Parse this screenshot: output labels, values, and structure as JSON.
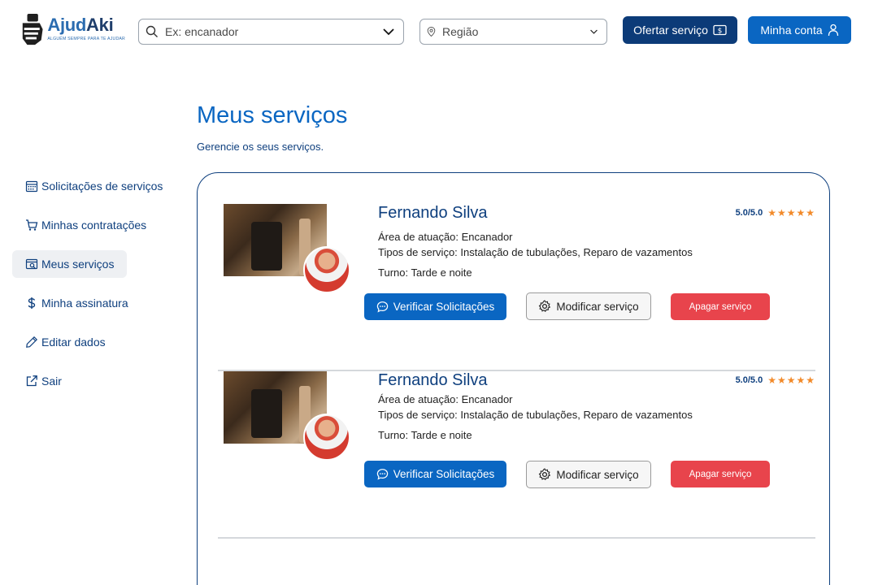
{
  "header": {
    "logo_name_part1": "Ajud",
    "logo_name_part2": "Aki",
    "logo_tagline": "ALGUÉM SEMPRE PARA TE AJUDAR",
    "search_placeholder": "Ex: encanador",
    "region_placeholder": "Região",
    "ofertar_label": "Ofertar serviço",
    "conta_label": "Minha conta"
  },
  "sidebar": {
    "items": [
      {
        "label": "Solicitações de serviços",
        "icon": "calendar-icon"
      },
      {
        "label": "Minhas contratações",
        "icon": "cart-icon"
      },
      {
        "label": "Meus serviços",
        "icon": "services-icon",
        "active": true
      },
      {
        "label": "Minha assinatura",
        "icon": "dollar-icon"
      },
      {
        "label": "Editar dados",
        "icon": "pencil-icon"
      },
      {
        "label": "Sair",
        "icon": "external-link-icon"
      }
    ]
  },
  "main": {
    "title": "Meus serviços",
    "subtitle": "Gerencie os seus serviços.",
    "services": [
      {
        "name": "Fernando Silva",
        "rating": "5.0/5.0",
        "stars": 5,
        "area": "Área de atuação: Encanador",
        "tipos": "Tipos de serviço: Instalação de tubulações, Reparo de vazamentos",
        "turno": "Turno: Tarde e noite",
        "verificar_label": "Verificar Solicitações",
        "modificar_label": "Modificar serviço",
        "apagar_label": "Apagar serviço"
      },
      {
        "name": "Fernando Silva",
        "rating": "5.0/5.0",
        "stars": 5,
        "area": "Área de atuação: Encanador",
        "tipos": "Tipos de serviço: Instalação de tubulações, Reparo de vazamentos",
        "turno": "Turno: Tarde e noite",
        "verificar_label": "Verificar Solicitações",
        "modificar_label": "Modificar serviço",
        "apagar_label": "Apagar serviço"
      }
    ]
  },
  "colors": {
    "primary": "#0a66c2",
    "dark_primary": "#0c3b78",
    "danger": "#e8444c",
    "star": "#f28a2a"
  }
}
